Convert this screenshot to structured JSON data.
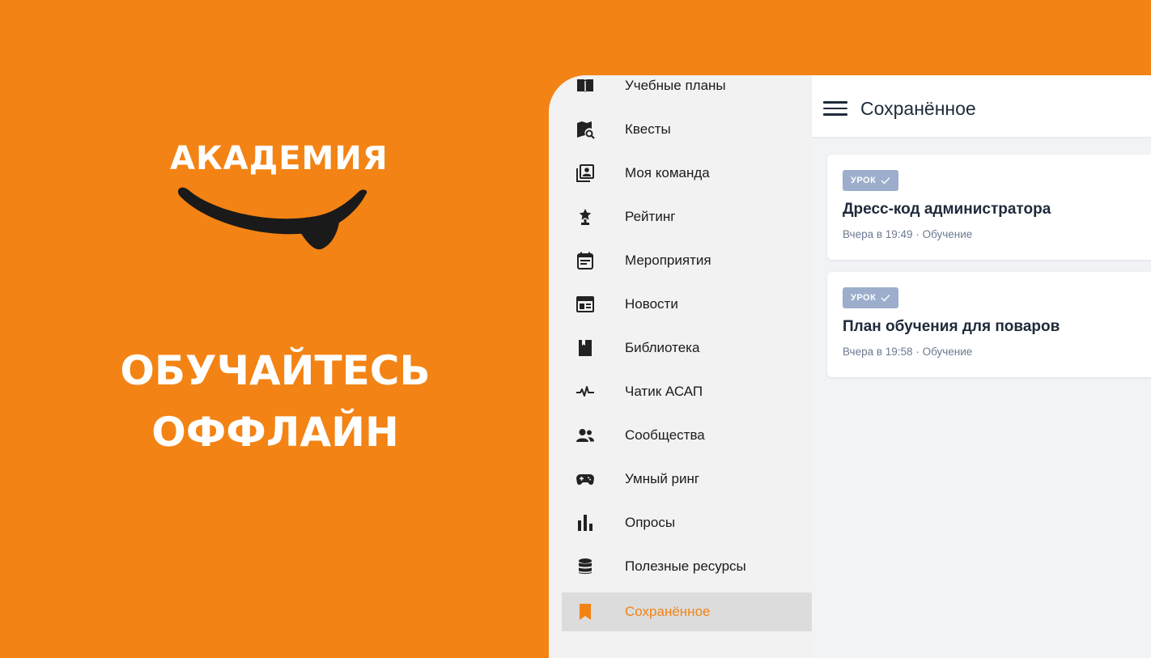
{
  "promo": {
    "logo_text": "АКАДЕМИЯ",
    "headline_line1": "ОБУЧАЙТЕСЬ",
    "headline_line2": "ОФФЛАЙН"
  },
  "colors": {
    "brand_orange": "#F38314",
    "drawer_bg": "#F2F2F2",
    "active_bg": "#DCDCDC",
    "badge_bg": "#9CAECB",
    "text_dark": "#1F2A3A"
  },
  "drawer": {
    "items": [
      {
        "label": "Учебные планы",
        "icon": "book-icon"
      },
      {
        "label": "Квесты",
        "icon": "map-search-icon"
      },
      {
        "label": "Моя команда",
        "icon": "team-icon"
      },
      {
        "label": "Рейтинг",
        "icon": "trophy-icon"
      },
      {
        "label": "Мероприятия",
        "icon": "calendar-icon"
      },
      {
        "label": "Новости",
        "icon": "news-icon"
      },
      {
        "label": "Библиотека",
        "icon": "library-icon"
      },
      {
        "label": "Чатик АСАП",
        "icon": "pulse-icon"
      },
      {
        "label": "Сообщества",
        "icon": "people-icon"
      },
      {
        "label": "Умный ринг",
        "icon": "gamepad-icon"
      },
      {
        "label": "Опросы",
        "icon": "bar-chart-icon"
      },
      {
        "label": "Полезные ресурсы",
        "icon": "database-icon"
      },
      {
        "label": "Сохранённое",
        "icon": "bookmark-icon",
        "active": true
      }
    ]
  },
  "appbar": {
    "title": "Сохранённое"
  },
  "cards": [
    {
      "badge": "УРОК",
      "title": "Дресс-код администратора",
      "meta": "Вчера в 19:49 · Обучение"
    },
    {
      "badge": "УРОК",
      "title": "План обучения для поваров",
      "meta": "Вчера в 19:58 · Обучение"
    }
  ]
}
